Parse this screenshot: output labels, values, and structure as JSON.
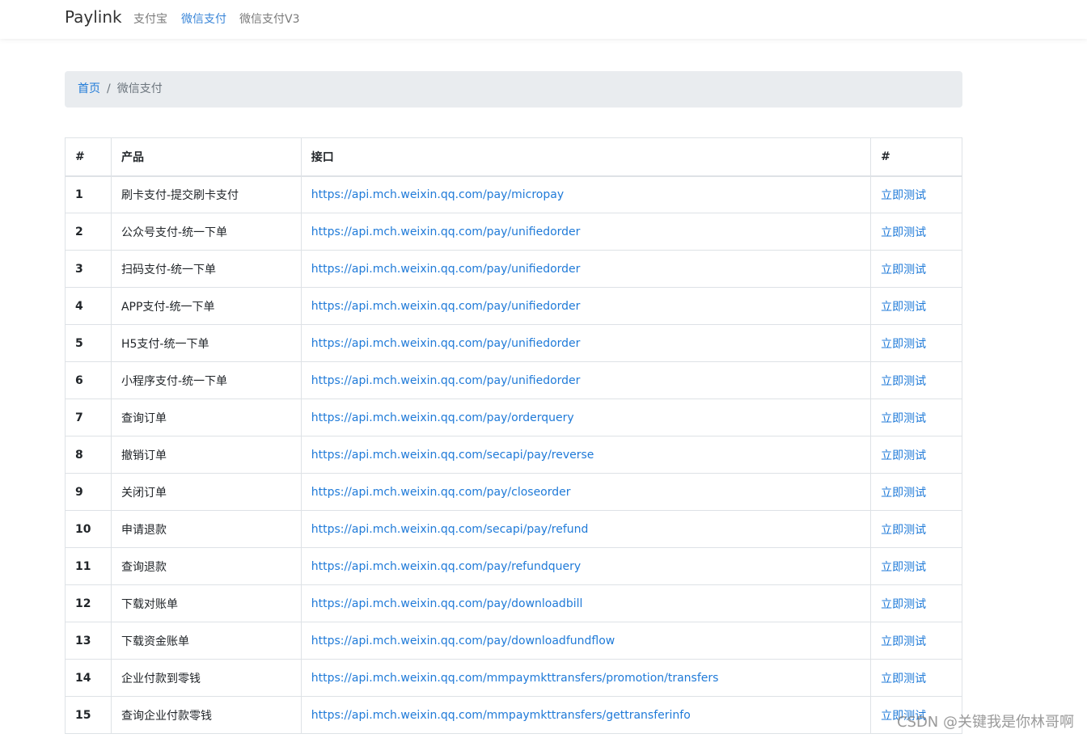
{
  "navbar": {
    "brand": "Paylink",
    "links": [
      "支付宝",
      "微信支付",
      "微信支付V3"
    ],
    "active_index": 1,
    "active_color": "#3a86d8"
  },
  "breadcrumb": {
    "home": "首页",
    "separator": "/",
    "current": "微信支付"
  },
  "table": {
    "headers": [
      "#",
      "产品",
      "接口",
      "#"
    ],
    "rows": [
      {
        "num": "1",
        "product": "刷卡支付-提交刷卡支付",
        "api": "https://api.mch.weixin.qq.com/pay/micropay",
        "action": "立即测试"
      },
      {
        "num": "2",
        "product": "公众号支付-统一下单",
        "api": "https://api.mch.weixin.qq.com/pay/unifiedorder",
        "action": "立即测试"
      },
      {
        "num": "3",
        "product": "扫码支付-统一下单",
        "api": "https://api.mch.weixin.qq.com/pay/unifiedorder",
        "action": "立即测试"
      },
      {
        "num": "4",
        "product": "APP支付-统一下单",
        "api": "https://api.mch.weixin.qq.com/pay/unifiedorder",
        "action": "立即测试"
      },
      {
        "num": "5",
        "product": "H5支付-统一下单",
        "api": "https://api.mch.weixin.qq.com/pay/unifiedorder",
        "action": "立即测试"
      },
      {
        "num": "6",
        "product": "小程序支付-统一下单",
        "api": "https://api.mch.weixin.qq.com/pay/unifiedorder",
        "action": "立即测试"
      },
      {
        "num": "7",
        "product": "查询订单",
        "api": "https://api.mch.weixin.qq.com/pay/orderquery",
        "action": "立即测试"
      },
      {
        "num": "8",
        "product": "撤销订单",
        "api": "https://api.mch.weixin.qq.com/secapi/pay/reverse",
        "action": "立即测试"
      },
      {
        "num": "9",
        "product": "关闭订单",
        "api": "https://api.mch.weixin.qq.com/pay/closeorder",
        "action": "立即测试"
      },
      {
        "num": "10",
        "product": "申请退款",
        "api": "https://api.mch.weixin.qq.com/secapi/pay/refund",
        "action": "立即测试"
      },
      {
        "num": "11",
        "product": "查询退款",
        "api": "https://api.mch.weixin.qq.com/pay/refundquery",
        "action": "立即测试"
      },
      {
        "num": "12",
        "product": "下载对账单",
        "api": "https://api.mch.weixin.qq.com/pay/downloadbill",
        "action": "立即测试"
      },
      {
        "num": "13",
        "product": "下载资金账单",
        "api": "https://api.mch.weixin.qq.com/pay/downloadfundflow",
        "action": "立即测试"
      },
      {
        "num": "14",
        "product": "企业付款到零钱",
        "api": "https://api.mch.weixin.qq.com/mmpaymkttransfers/promotion/transfers",
        "action": "立即测试"
      },
      {
        "num": "15",
        "product": "查询企业付款零钱",
        "api": "https://api.mch.weixin.qq.com/mmpaymkttransfers/gettransferinfo",
        "action": "立即测试"
      }
    ]
  },
  "watermark": "CSDN @关键我是你林哥啊"
}
